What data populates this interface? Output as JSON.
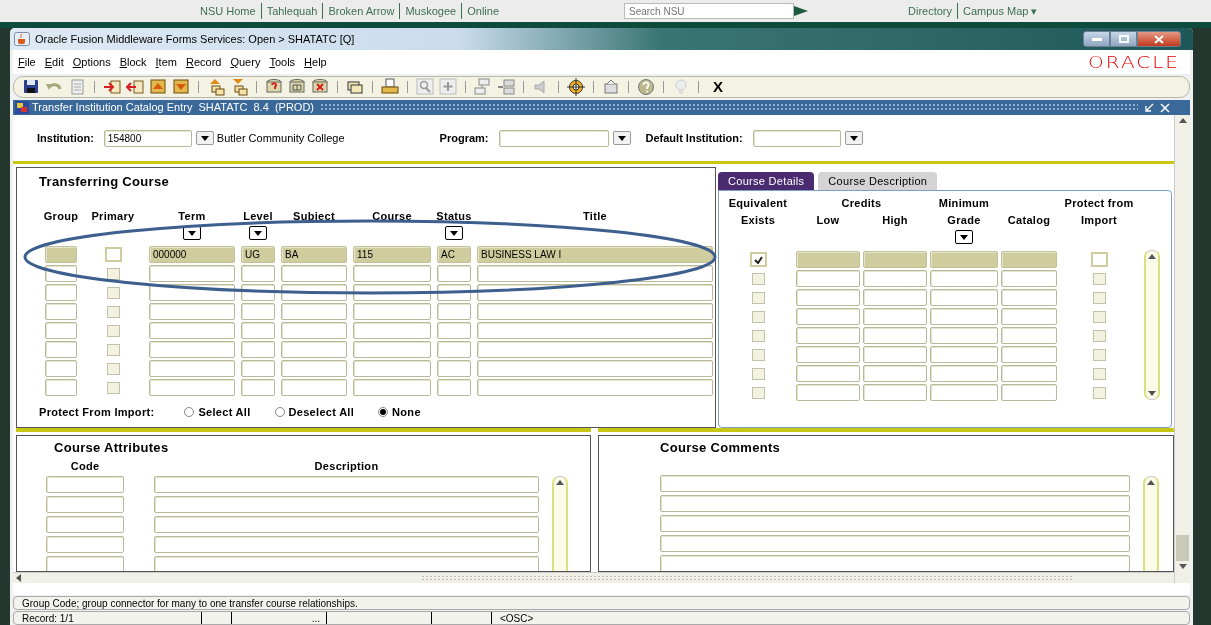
{
  "browser_header": {
    "links": [
      "NSU Home",
      "Tahlequah",
      "Broken Arrow",
      "Muskogee",
      "Online"
    ],
    "search_placeholder": "Search NSU",
    "right_links": [
      "Directory",
      "Campus Map ▾"
    ]
  },
  "window": {
    "title": "Oracle Fusion Middleware Forms Services:  Open > SHATATC [Q]"
  },
  "menu": [
    "File",
    "Edit",
    "Options",
    "Block",
    "Item",
    "Record",
    "Query",
    "Tools",
    "Help"
  ],
  "logo": "ORACLE",
  "toolbar": {
    "exit_label": "X"
  },
  "form": {
    "title": "Transfer Institution Catalog Entry  SHATATC  8.4  (PROD)"
  },
  "key_block": [
    {
      "label": "Institution:",
      "value": "154800",
      "description": "Butler Community College"
    },
    {
      "label": "Program:"
    },
    {
      "label": "Default Institution:"
    }
  ],
  "transferring_course": {
    "title": "Transferring Course",
    "columns": [
      {
        "label": "Group",
        "kind": "text"
      },
      {
        "label": "Primary",
        "kind": "checkbox"
      },
      {
        "label": "Term",
        "kind": "text",
        "dropdown": true
      },
      {
        "label": "Level",
        "kind": "text",
        "dropdown": true
      },
      {
        "label": "Subject",
        "kind": "text"
      },
      {
        "label": "Course",
        "kind": "text"
      },
      {
        "label": "Status",
        "kind": "text",
        "dropdown": true
      },
      {
        "label": "Title",
        "kind": "text"
      }
    ],
    "rows": [
      {
        "selected": true,
        "cells": [
          null,
          false,
          "000000",
          "UG",
          "BA",
          "115",
          "AC",
          "BUSINESS LAW I"
        ]
      },
      {
        "selected": false,
        "cells": [
          null,
          false,
          null,
          null,
          null,
          null,
          null,
          null
        ]
      },
      {
        "selected": false,
        "cells": [
          null,
          false,
          null,
          null,
          null,
          null,
          null,
          null
        ]
      },
      {
        "selected": false,
        "cells": [
          null,
          false,
          null,
          null,
          null,
          null,
          null,
          null
        ]
      },
      {
        "selected": false,
        "cells": [
          null,
          false,
          null,
          null,
          null,
          null,
          null,
          null
        ]
      },
      {
        "selected": false,
        "cells": [
          null,
          false,
          null,
          null,
          null,
          null,
          null,
          null
        ]
      },
      {
        "selected": false,
        "cells": [
          null,
          false,
          null,
          null,
          null,
          null,
          null,
          null
        ]
      },
      {
        "selected": false,
        "cells": [
          null,
          false,
          null,
          null,
          null,
          null,
          null,
          null
        ]
      }
    ],
    "protect_from_import": {
      "label": "Protect From Import:",
      "options": [
        {
          "label": "Select All",
          "selected": false
        },
        {
          "label": "Deselect All",
          "selected": false
        },
        {
          "label": "None",
          "selected": true
        }
      ]
    }
  },
  "tabs": [
    {
      "label": "Course Details",
      "selected": true
    },
    {
      "label": "Course Description",
      "selected": false
    }
  ],
  "course_details": {
    "credits_label": "Credits",
    "columns": [
      {
        "top": "Equivalent",
        "label": "Exists",
        "kind": "checkbox"
      },
      {
        "label": "Low",
        "kind": "text"
      },
      {
        "label": "High",
        "kind": "text"
      },
      {
        "top": "Minimum",
        "label": "Grade",
        "kind": "text",
        "dropdown": true
      },
      {
        "label": "Catalog",
        "kind": "text"
      },
      {
        "top": "Protect from",
        "label": "Import",
        "kind": "checkbox"
      }
    ],
    "rows": [
      {
        "selected": true,
        "cells": [
          true,
          null,
          null,
          null,
          null,
          false
        ]
      },
      {
        "selected": false,
        "cells": [
          false,
          null,
          null,
          null,
          null,
          false
        ]
      },
      {
        "selected": false,
        "cells": [
          false,
          null,
          null,
          null,
          null,
          false
        ]
      },
      {
        "selected": false,
        "cells": [
          false,
          null,
          null,
          null,
          null,
          false
        ]
      },
      {
        "selected": false,
        "cells": [
          false,
          null,
          null,
          null,
          null,
          false
        ]
      },
      {
        "selected": false,
        "cells": [
          false,
          null,
          null,
          null,
          null,
          false
        ]
      },
      {
        "selected": false,
        "cells": [
          false,
          null,
          null,
          null,
          null,
          false
        ]
      },
      {
        "selected": false,
        "cells": [
          false,
          null,
          null,
          null,
          null,
          false
        ]
      }
    ]
  },
  "course_attributes": {
    "title": "Course Attributes",
    "columns": [
      "Code",
      "Description"
    ],
    "rows": [
      {
        "selected": false
      },
      {
        "selected": false
      },
      {
        "selected": false
      },
      {
        "selected": false
      },
      {
        "selected": false
      }
    ]
  },
  "course_comments": {
    "title": "Course Comments",
    "rows": [
      {
        "selected": false
      },
      {
        "selected": false
      },
      {
        "selected": false
      },
      {
        "selected": false
      },
      {
        "selected": false
      }
    ]
  },
  "status_bar": {
    "hint": "Group Code; group connector for many to one transfer course relationships.",
    "record": "Record: 1/1",
    "ellipsis": "...",
    "osc": "<OSC>"
  },
  "annotation": {
    "kind": "ellipse"
  }
}
